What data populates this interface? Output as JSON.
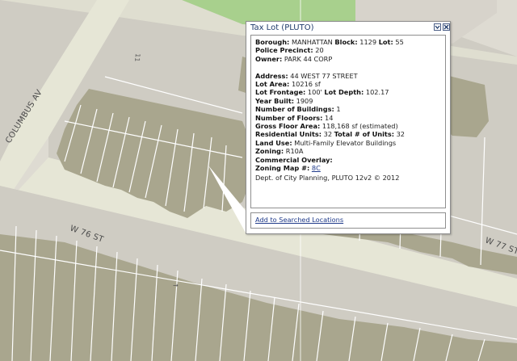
{
  "map": {
    "streets": {
      "columbus_av": "COLUMBUS AV",
      "w76": "W 76 ST",
      "w77": "W 77 ST"
    },
    "colors": {
      "block": "#cfccc3",
      "street": "#e8e8d8",
      "building": "#a9a68e",
      "building_dark": "#9b987f",
      "park": "#a8d08d",
      "lot_lines": "#ffffff"
    }
  },
  "popup": {
    "title": "Tax Lot (PLUTO)",
    "minimize_icon": "chevron-down-icon",
    "close_icon": "close-icon",
    "labels": {
      "borough": "Borough:",
      "block": "Block:",
      "lot": "Lot:",
      "precinct": "Police Precinct:",
      "owner": "Owner:",
      "address": "Address:",
      "lot_area": "Lot Area:",
      "lot_frontage": "Lot Frontage:",
      "lot_depth": "Lot Depth:",
      "year_built": "Year Built:",
      "num_buildings": "Number of Buildings:",
      "num_floors": "Number of Floors:",
      "gross_floor_area": "Gross Floor Area:",
      "residential_units": "Residential Units:",
      "total_units": "Total # of Units:",
      "land_use": "Land Use:",
      "zoning": "Zoning:",
      "commercial_overlay": "Commercial Overlay:",
      "zoning_map": "Zoning Map #:"
    },
    "values": {
      "borough": "MANHATTAN",
      "block": "1129",
      "lot": "55",
      "precinct": "20",
      "owner": "PARK 44 CORP",
      "address": "44 WEST 77 STREET",
      "lot_area": "10216 sf",
      "lot_frontage": "100'",
      "lot_depth": "102.17",
      "year_built": "1909",
      "num_buildings": "1",
      "num_floors": "14",
      "gross_floor_area": "118,168 sf (estimated)",
      "residential_units": "32",
      "total_units": "32",
      "land_use": "Multi-Family Elevator Buildings",
      "zoning": "R10A",
      "commercial_overlay": "",
      "zoning_map": "8C"
    },
    "source": "Dept. of City Planning, PLUTO 12v2 © 2012",
    "add_link": "Add to Searched Locations"
  }
}
